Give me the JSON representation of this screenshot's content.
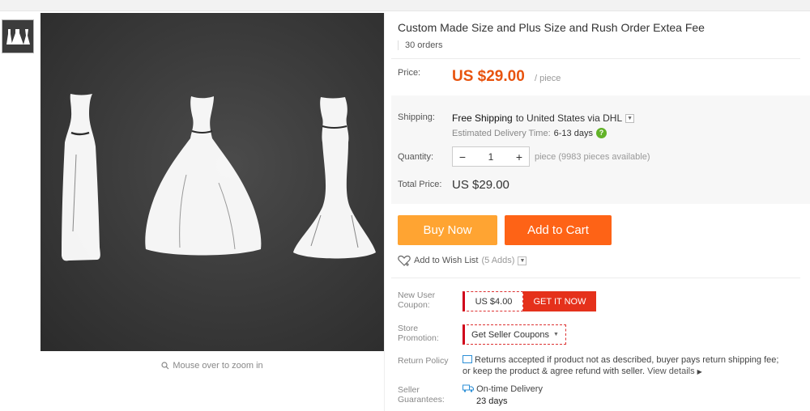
{
  "product": {
    "title": "Custom Made Size and Plus Size and Rush Order Extea Fee",
    "orders": "30 orders",
    "zoom_hint": "Mouse over to zoom in"
  },
  "price": {
    "label": "Price:",
    "value": "US $29.00",
    "unit": "/ piece"
  },
  "shipping": {
    "label": "Shipping:",
    "free": "Free Shipping",
    "to": "to United States via DHL",
    "eta_label": "Estimated Delivery Time:",
    "eta_days": "6-13 days"
  },
  "quantity": {
    "label": "Quantity:",
    "minus": "−",
    "value": "1",
    "plus": "+",
    "note": "piece (9983 pieces available)"
  },
  "total": {
    "label": "Total Price:",
    "value": "US $29.00"
  },
  "actions": {
    "buy_now": "Buy Now",
    "add_to_cart": "Add to Cart",
    "wishlist": "Add to Wish List",
    "wishlist_count": "(5 Adds)"
  },
  "coupon": {
    "label_line1": "New User",
    "label_line2": "Coupon:",
    "amount": "US $4.00",
    "get": "GET IT NOW"
  },
  "promotion": {
    "label_line1": "Store",
    "label_line2": "Promotion:",
    "button": "Get Seller Coupons"
  },
  "return_policy": {
    "label": "Return Policy",
    "text_line1": "Returns accepted if product not as described, buyer pays return shipping fee;",
    "text_line2": "or keep the product & agree refund with seller.",
    "link": "View details"
  },
  "guarantees": {
    "label_line1": "Seller",
    "label_line2": "Guarantees:",
    "item": "On-time Delivery",
    "days": "23 days"
  },
  "colors": {
    "price": "#e8540f",
    "buy_now": "#ffa432",
    "add_to_cart": "#fe6316",
    "coupon_red": "#e5311b"
  },
  "icons": [
    "search-icon",
    "chevron-down-icon",
    "question-icon",
    "heart-icon",
    "document-icon",
    "truck-icon"
  ]
}
